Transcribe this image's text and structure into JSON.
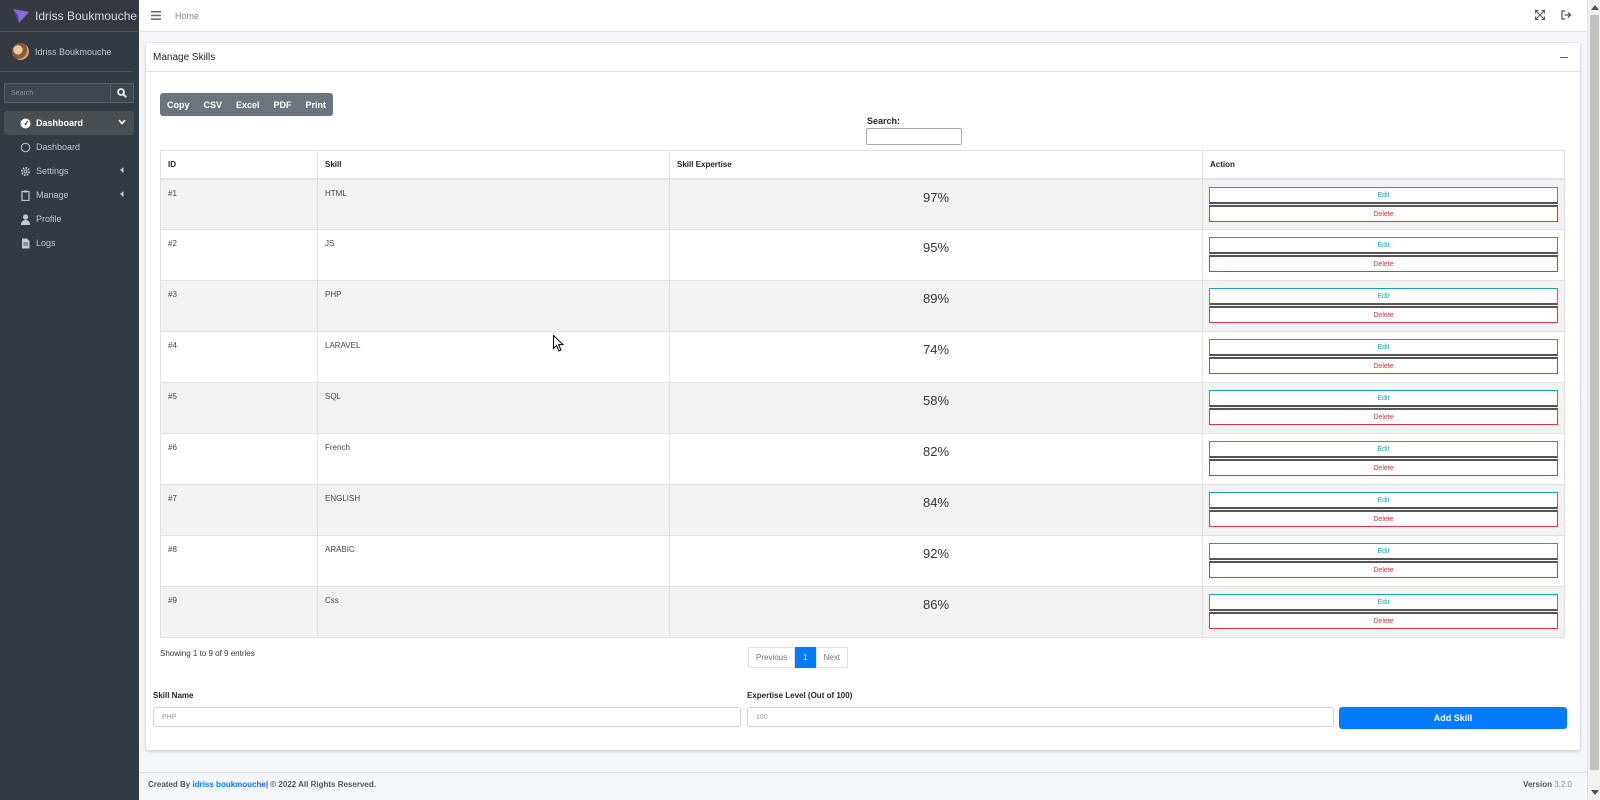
{
  "brand": {
    "name": "Idriss Boukmouche"
  },
  "user": {
    "name": "Idriss Boukmouche"
  },
  "sidebar": {
    "search_placeholder": "Search",
    "items": [
      {
        "label": "Dashboard",
        "icon": "tachometer-icon",
        "active": true
      },
      {
        "label": "Dashboard",
        "icon": "circle-icon"
      },
      {
        "label": "Settings",
        "icon": "gear-icon"
      },
      {
        "label": "Manage",
        "icon": "clipboard-icon"
      },
      {
        "label": "Profile",
        "icon": "user-icon"
      },
      {
        "label": "Logs",
        "icon": "file-icon"
      }
    ]
  },
  "navbar": {
    "home": "Home"
  },
  "card": {
    "title": "Manage Skills",
    "export_buttons": [
      "Copy",
      "CSV",
      "Excel",
      "PDF",
      "Print"
    ],
    "search_label": "Search:",
    "table": {
      "headers": [
        "ID",
        "Skill",
        "Skill Expertise",
        "Action"
      ],
      "edit_label": "Edit",
      "delete_label": "Delete",
      "rows": [
        {
          "id": "#1",
          "skill": "HTML",
          "expertise": "97%"
        },
        {
          "id": "#2",
          "skill": "JS",
          "expertise": "95%"
        },
        {
          "id": "#3",
          "skill": "PHP",
          "expertise": "89%"
        },
        {
          "id": "#4",
          "skill": "LARAVEL",
          "expertise": "74%"
        },
        {
          "id": "#5",
          "skill": "SQL",
          "expertise": "58%"
        },
        {
          "id": "#6",
          "skill": "French",
          "expertise": "82%"
        },
        {
          "id": "#7",
          "skill": "ENGLISH",
          "expertise": "84%"
        },
        {
          "id": "#8",
          "skill": "ARABIC",
          "expertise": "92%"
        },
        {
          "id": "#9",
          "skill": "Css",
          "expertise": "86%"
        }
      ]
    },
    "showing": "Showing 1 to 9 of 9 entries",
    "pagination": {
      "previous": "Previous",
      "current": "1",
      "next": "Next"
    },
    "form": {
      "skill_label": "Skill Name",
      "skill_placeholder": "PHP",
      "level_label": "Expertise Level (Out of 100)",
      "level_placeholder": "100",
      "add_button": "Add Skill"
    }
  },
  "footer": {
    "created_by": "Created By",
    "author": "idriss boukmouche",
    "rights": "| © 2022 All Rights Reserved.",
    "version_label": "Version",
    "version": "3.2.0"
  },
  "colors": {
    "sidebar": "#343a40",
    "primary": "#007bff",
    "info": "#17a2b8",
    "danger": "#dc3545"
  }
}
